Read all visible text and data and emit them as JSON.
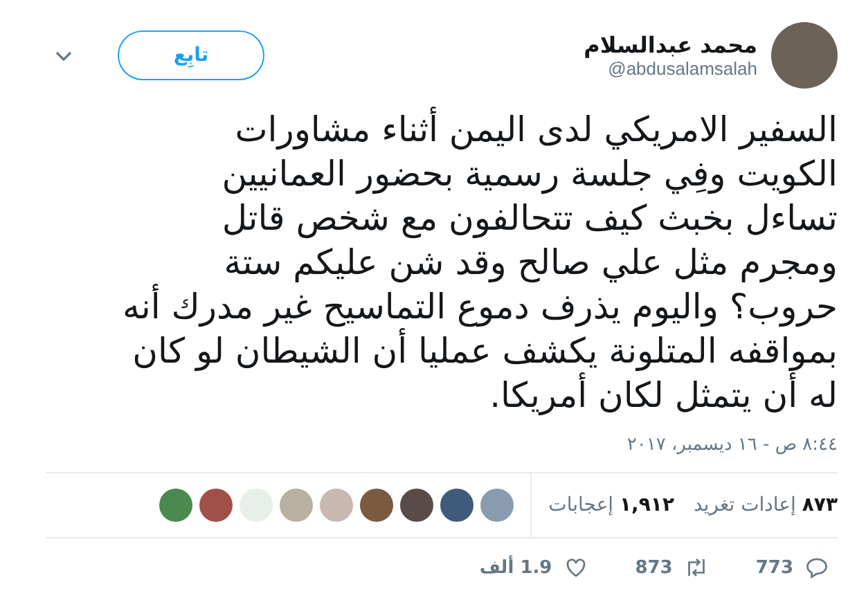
{
  "author": {
    "name": "محمد عبدالسلام",
    "handle": "@abdusalamsalah"
  },
  "follow_button": {
    "label": "تابِع"
  },
  "tweet_lines": [
    "السفير الامريكي لدى اليمن أثناء مشاورات",
    "الكويت وفِي جلسة رسمية بحضور العمانيين",
    "تساءل بخبث كيف تتحالفون مع شخص قاتل",
    "ومجرم مثل علي صالح وقد شن عليكم ستة",
    "حروب؟ واليوم يذرف دموع التماسيح غير مدرك أنه",
    "بمواقفه المتلونة يكشف عمليا أن الشيطان لو كان",
    "له أن يتمثل لكان أمريكا."
  ],
  "timestamp": "٨:٤٤ ص - ١٦ ديسمبر، ٢٠١٧",
  "stats": [
    {
      "count": "٨٧٣",
      "label": "إعادات تغريد"
    },
    {
      "count": "١,٩١٢",
      "label": "إعجابات"
    }
  ],
  "liker_avatars": [
    {
      "color": "#8a9bb0"
    },
    {
      "color": "#3f5a7a"
    },
    {
      "color": "#5a4a48"
    },
    {
      "color": "#7a5a40"
    },
    {
      "color": "#c9b8b0"
    },
    {
      "color": "#b8b0a0"
    },
    {
      "color": "#e8efe8"
    },
    {
      "color": "#a05048"
    },
    {
      "color": "#4a8a50"
    }
  ],
  "actions": [
    {
      "kind": "reply",
      "count": "773"
    },
    {
      "kind": "retweet",
      "count": "873"
    },
    {
      "kind": "like",
      "count": "1.9 ألف"
    }
  ]
}
